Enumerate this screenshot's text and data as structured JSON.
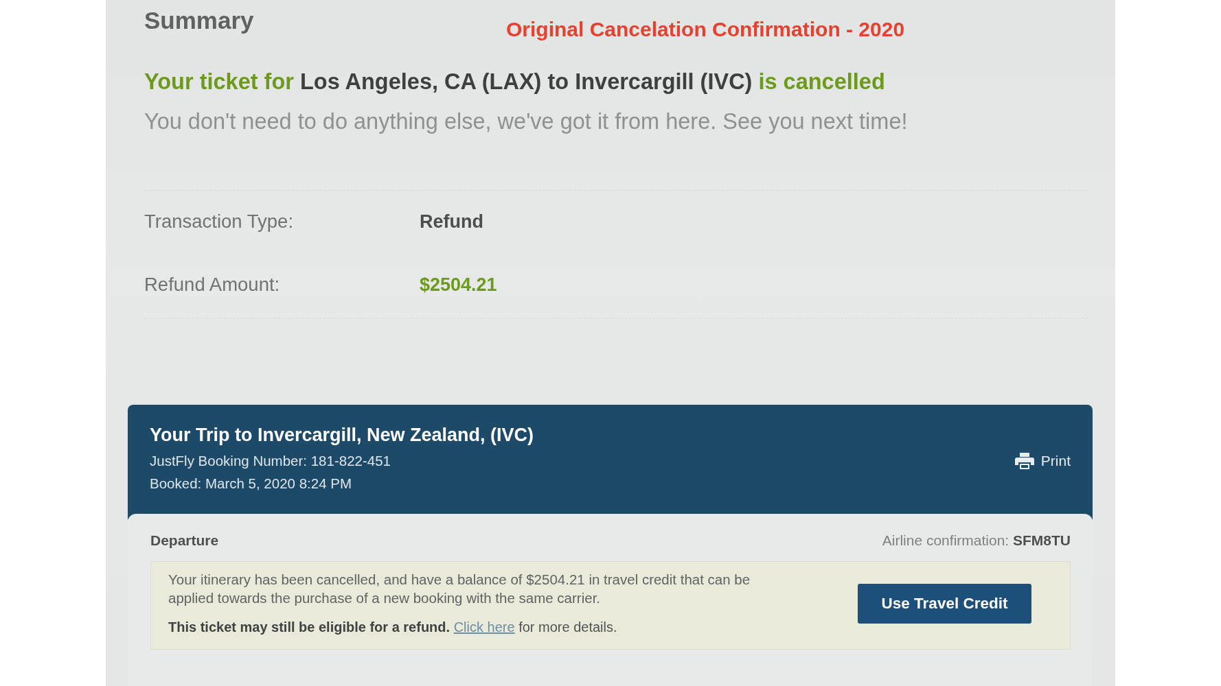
{
  "summary": {
    "title": "Summary",
    "annotation": "Original Cancelation Confirmation - 2020",
    "headline": [
      {
        "text": "Your ticket for",
        "kind": "status"
      },
      {
        "text": "Los Angeles, CA (LAX) to Invercargill (IVC)",
        "kind": "route"
      },
      {
        "text": "is cancelled",
        "kind": "status"
      }
    ],
    "message": "You don't need to do anything else, we've got it from here. See you next time!"
  },
  "details": [
    {
      "label": "Transaction Type:",
      "value": "Refund",
      "kind": "plain"
    },
    {
      "label": "Refund Amount:",
      "value": "$2504.21",
      "kind": "amount"
    }
  ],
  "trip": {
    "title": "Your Trip to Invercargill, New Zealand, (IVC)",
    "booking_number": "JustFly Booking Number: 181-822-451",
    "booked": "Booked: March 5, 2020 8:24 PM",
    "print": "Print"
  },
  "departure": {
    "label": "Departure",
    "confirmation_label": "Airline confirmation:",
    "confirmation_code": "SFM8TU",
    "notice": "Your itinerary has been cancelled, and have a balance of $2504.21 in travel credit that can be applied towards the purchase of a new booking with the same carrier.",
    "refund_note": "**This ticket may still be eligible for a refund.**",
    "refund_link": "Click here",
    "refund_after": "for more details.",
    "button": "Use Travel Credit"
  }
}
